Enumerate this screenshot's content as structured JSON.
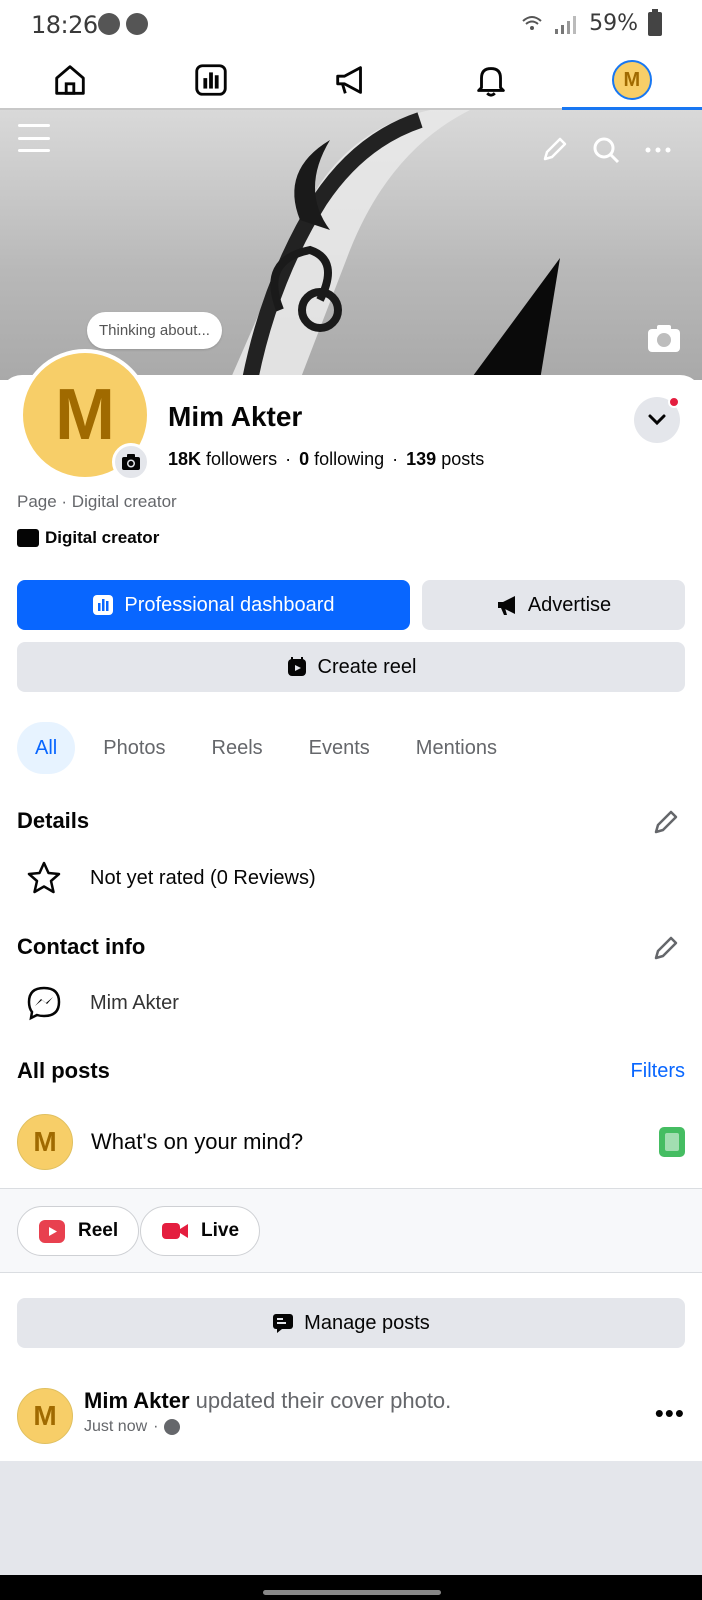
{
  "status_bar": {
    "time": "18:26",
    "battery": "59%"
  },
  "nav": {
    "tabs": [
      {
        "name": "home-icon"
      },
      {
        "name": "dashboard-icon"
      },
      {
        "name": "megaphone-icon"
      },
      {
        "name": "bell-icon"
      },
      {
        "name": "profile-avatar",
        "letter": "M",
        "active": true
      }
    ]
  },
  "cover": {
    "thought_bubble": "Thinking about..."
  },
  "profile": {
    "avatar_letter": "M",
    "name": "Mim Akter",
    "followers_count": "18K",
    "followers_label": "followers",
    "following_count": "0",
    "following_label": "following",
    "posts_count": "139",
    "posts_label": "posts",
    "category": "Page · Digital creator",
    "creator_label": "Digital creator"
  },
  "actions": {
    "professional_dashboard": "Professional dashboard",
    "advertise": "Advertise",
    "create_reel": "Create reel"
  },
  "tabs": [
    {
      "label": "All",
      "active": true
    },
    {
      "label": "Photos"
    },
    {
      "label": "Reels"
    },
    {
      "label": "Events"
    },
    {
      "label": "Mentions"
    }
  ],
  "details": {
    "title": "Details",
    "rating": "Not yet rated (0 Reviews)"
  },
  "contact": {
    "title": "Contact info",
    "messenger_name": "Mim Akter"
  },
  "all_posts": {
    "title": "All posts",
    "filters": "Filters",
    "composer_placeholder": "What's on your mind?",
    "chip_reel": "Reel",
    "chip_live": "Live",
    "manage_posts": "Manage posts"
  },
  "post": {
    "author": "Mim Akter",
    "action": " updated their cover photo.",
    "time": "Just now",
    "sep": "·"
  },
  "colors": {
    "accent": "#0866ff",
    "avatar": "#f7ce68",
    "notification": "#e41e3f"
  }
}
